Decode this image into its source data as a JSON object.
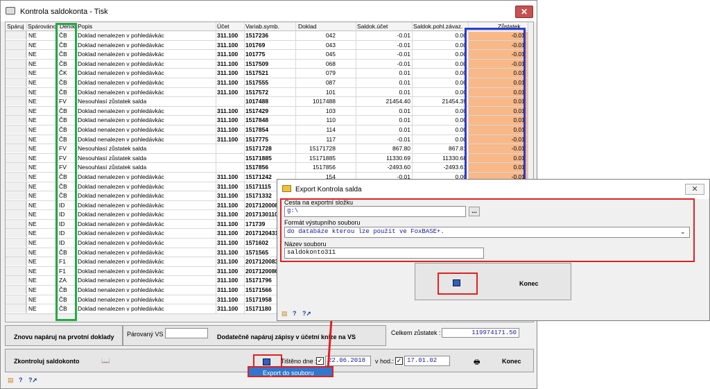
{
  "main_window": {
    "title": "Kontrola saldokonta - Tisk",
    "close": "✕"
  },
  "grid": {
    "columns": [
      "Spáruj",
      "Spárováno",
      "Deník",
      "Popis",
      "Účet",
      "Variab.symb.",
      "Doklad",
      "Saldok.účet",
      "Saldok.pohl.závaz.",
      "Zůstatek"
    ],
    "rows": [
      [
        "NE",
        "ČB",
        "Doklad nenalezen v pohledávkác",
        "311.100",
        "1517236",
        "042",
        "-0.01",
        "0.00",
        "-0.01"
      ],
      [
        "NE",
        "ČB",
        "Doklad nenalezen v pohledávkác",
        "311.100",
        "101769",
        "043",
        "-0.01",
        "0.00",
        "-0.01"
      ],
      [
        "NE",
        "ČB",
        "Doklad nenalezen v pohledávkác",
        "311.100",
        "101775",
        "045",
        "-0.01",
        "0.00",
        "-0.01"
      ],
      [
        "NE",
        "ČB",
        "Doklad nenalezen v pohledávkác",
        "311.100",
        "1517509",
        "068",
        "-0.01",
        "0.00",
        "-0.01"
      ],
      [
        "NE",
        "ČK",
        "Doklad nenalezen v pohledávkác",
        "311.100",
        "1517521",
        "079",
        "0.01",
        "0.00",
        "0.01"
      ],
      [
        "NE",
        "ČB",
        "Doklad nenalezen v pohledávkác",
        "311.100",
        "1517555",
        "087",
        "0.01",
        "0.00",
        "0.01"
      ],
      [
        "NE",
        "ČB",
        "Doklad nenalezen v pohledávkác",
        "311.100",
        "1517572",
        "101",
        "0.01",
        "0.00",
        "0.01"
      ],
      [
        "NE",
        "FV",
        "Nesouhlasí zůstatek salda",
        "",
        "1017488",
        "1017488",
        "21454.40",
        "21454.39",
        "0.01"
      ],
      [
        "NE",
        "ČB",
        "Doklad nenalezen v pohledávkác",
        "311.100",
        "1517429",
        "103",
        "0.01",
        "0.00",
        "0.01"
      ],
      [
        "NE",
        "ČB",
        "Doklad nenalezen v pohledávkác",
        "311.100",
        "1517848",
        "110",
        "0.01",
        "0.00",
        "0.01"
      ],
      [
        "NE",
        "ČB",
        "Doklad nenalezen v pohledávkác",
        "311.100",
        "1517854",
        "114",
        "0.01",
        "0.00",
        "0.01"
      ],
      [
        "NE",
        "ČB",
        "Doklad nenalezen v pohledávkác",
        "311.100",
        "1517775",
        "117",
        "-0.01",
        "0.00",
        "-0.01"
      ],
      [
        "NE",
        "FV",
        "Nesouhlasí zůstatek salda",
        "",
        "15171728",
        "15171728",
        "867.80",
        "867.81",
        "-0.01"
      ],
      [
        "NE",
        "FV",
        "Nesouhlasí zůstatek salda",
        "",
        "15171885",
        "15171885",
        "11330.69",
        "11330.68",
        "0.01"
      ],
      [
        "NE",
        "FV",
        "Nesouhlasí zůstatek salda",
        "",
        "1517856",
        "1517856",
        "-2493.60",
        "-2493.61",
        "0.01"
      ],
      [
        "NE",
        "ČB",
        "Doklad nenalezen v pohledávkác",
        "311.100",
        "15171242",
        "154",
        "-0.01",
        "0.00",
        "-0.01"
      ],
      [
        "NE",
        "ČB",
        "Doklad nenalezen v pohledávkác",
        "311.100",
        "15171115",
        "",
        "",
        "",
        ""
      ],
      [
        "NE",
        "ČB",
        "Doklad nenalezen v pohledávkác",
        "311.100",
        "15171332",
        "",
        "",
        "",
        ""
      ],
      [
        "NE",
        "ID",
        "Doklad nenalezen v pohledávkác",
        "311.100",
        "2017120008",
        "",
        "",
        "",
        ""
      ],
      [
        "NE",
        "ID",
        "Doklad nenalezen v pohledávkác",
        "311.100",
        "2017130110",
        "",
        "",
        "",
        ""
      ],
      [
        "NE",
        "ID",
        "Doklad nenalezen v pohledávkác",
        "311.100",
        "171739",
        "",
        "",
        "",
        ""
      ],
      [
        "NE",
        "ID",
        "Doklad nenalezen v pohledávkác",
        "311.100",
        "2017120431",
        "",
        "",
        "",
        ""
      ],
      [
        "NE",
        "ID",
        "Doklad nenalezen v pohledávkác",
        "311.100",
        "1571602",
        "",
        "",
        "",
        ""
      ],
      [
        "NE",
        "ČB",
        "Doklad nenalezen v pohledávkác",
        "311.100",
        "1571565",
        "",
        "",
        "",
        ""
      ],
      [
        "NE",
        "F1",
        "Doklad nenalezen v pohledávkác",
        "311.100",
        "20171200831",
        "",
        "",
        "",
        ""
      ],
      [
        "NE",
        "F1",
        "Doklad nenalezen v pohledávkác",
        "311.100",
        "20171200861",
        "",
        "",
        "",
        ""
      ],
      [
        "NE",
        "ZA",
        "Doklad nenalezen v pohledávkác",
        "311.100",
        "15171796",
        "",
        "",
        "",
        ""
      ],
      [
        "NE",
        "ČB",
        "Doklad nenalezen v pohledávkác",
        "311.100",
        "15171566",
        "",
        "",
        "",
        ""
      ],
      [
        "NE",
        "ČB",
        "Doklad nenalezen v pohledávkác",
        "311.100",
        "15171958",
        "",
        "",
        "",
        ""
      ],
      [
        "NE",
        "ČB",
        "Doklad nenalezen v pohledávkác",
        "311.100",
        "15171180",
        "",
        "",
        "",
        ""
      ]
    ]
  },
  "bottom": {
    "reparovat_label": "Znovu napáruj na prvotní doklady",
    "parovany_vs_label": "Párovaný VS",
    "dodatecne_label": "Dodatečně napáruj zápisy v účetní knize na VS",
    "celkem_label": "Celkem zůstatek :",
    "celkem_value": "119974171.50",
    "zkontroluj_label": "Zkontroluj saldokonto",
    "tisteno_label": "Tištěno dne :",
    "tisteno_value": "22.06.2018",
    "hod_label": "v hod.:",
    "hod_value": "17.01.02",
    "konec_label": "Konec",
    "check_mark": "✓"
  },
  "context_menu": {
    "export_label": "Export do souboru"
  },
  "export_dialog": {
    "title": "Export Kontrola salda",
    "close": "✕",
    "path_label": "Cesta na exportní složku",
    "path_value": "g:\\",
    "browse_label": "...",
    "format_label": "Formát výstupního souboru",
    "format_value": "do databáze kterou lze použít ve FoxBASE+.",
    "filename_label": "Název souboru",
    "filename_value": "saldokonto311",
    "konec_label": "Konec"
  },
  "colors": {
    "highlight_red": "#e02020",
    "highlight_green": "#22aa44",
    "highlight_blue": "#2a3ad0",
    "zustatek_fill": "#f8b888",
    "menu_blue": "#3377cc"
  }
}
